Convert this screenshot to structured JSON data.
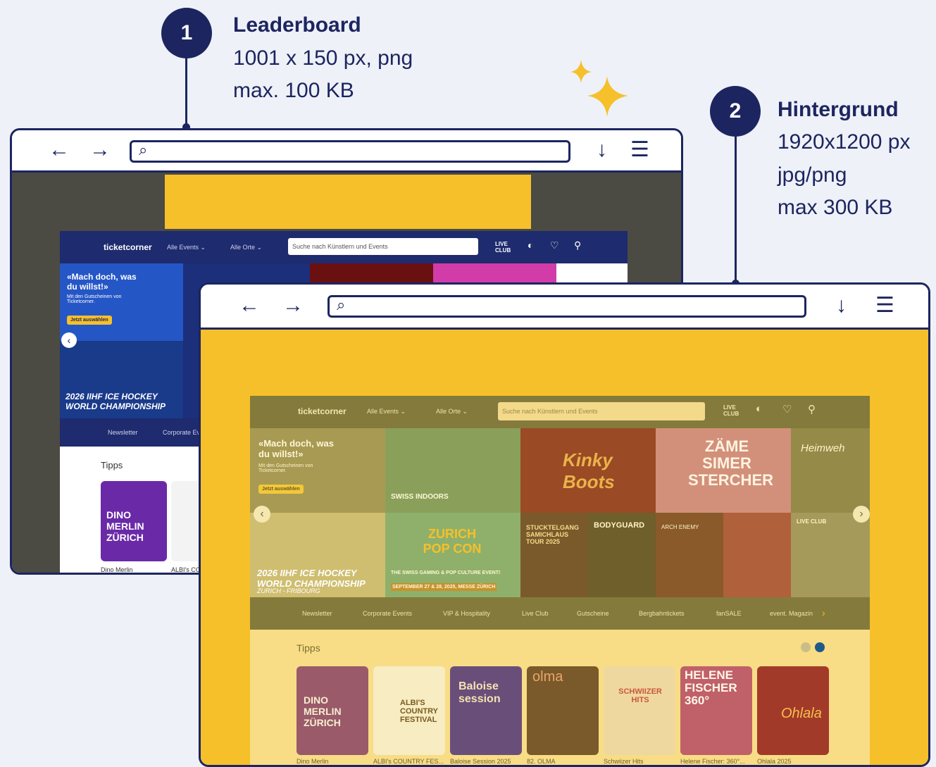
{
  "callout1": {
    "number": "1",
    "title": "Leaderboard",
    "lines": [
      "1001 x 150 px, png",
      "max. 100 KB"
    ]
  },
  "callout2": {
    "number": "2",
    "title": "Hintergrund",
    "lines": [
      "1920x1200 px",
      "jpg/png",
      "max 300 KB"
    ]
  },
  "browser": {
    "back": "←",
    "forward": "→",
    "search_icon": "🔍",
    "download": "↓",
    "menu": "☰"
  },
  "site": {
    "logo": "ticketcorner",
    "nav_events": "Alle Events ⌄",
    "nav_places": "Alle Orte ⌄",
    "search_placeholder": "Suche nach Künstlern und Events",
    "live_club": "LIVE CLUB",
    "promo_title": "«Mach doch, was du willst!»",
    "promo_sub": "Mit den Gutscheinen von Ticketcorner.",
    "promo_button": "Jetzt auswählen",
    "hockey_title": "2026 IIHF ICE HOCKEY WORLD CHAMPIONSHIP",
    "hockey_sub": "ZURICH - FRIBOURG",
    "tiles": [
      "SWISS INDOORS",
      "Kinky Boots",
      "ZÄME SIMER STERCHER",
      "Heimweh",
      "ZURICH POP CON",
      "STUCKTELGANG SAMICHLAUS TOUR 2025",
      "BODYGUARD",
      "ARCH ENEMY",
      "",
      "LIVE CLUB"
    ],
    "popcon_sub": "THE SWISS GAMING & POP CULTURE EVENT!",
    "popcon_date": "SEPTEMBER 27 & 28, 2025, MESSE ZÜRICH",
    "subnav": [
      "Newsletter",
      "Corporate Events",
      "VIP & Hospitality",
      "Live Club",
      "Gutscheine",
      "Bergbahntickets",
      "fanSALE",
      "event. Magazin"
    ],
    "subnav_small": [
      "Newsletter",
      "Corporate Ev"
    ],
    "tipps": "Tipps",
    "cards": [
      "Dino Merlin",
      "ALBI's COUNTRY FES...",
      "Baloise Session 2025",
      "82. OLMA",
      "Schwiizer Hits",
      "Helene Fischer: 360°...",
      "Ohlala 2025"
    ],
    "cards_small": [
      "Dino Merlin",
      "ALBI's CO"
    ],
    "card_titles": [
      "DINO MERLIN ZÜRICH",
      "ALBI'S COUNTRY FESTIVAL",
      "Baloise session",
      "olma",
      "SCHWIIZER HITS",
      "HELENE FISCHER 360°",
      "Ohlala"
    ]
  },
  "colors": {
    "navy": "#1d2560",
    "yellow": "#f6c02b",
    "site_nav": "#1e2b6e"
  }
}
